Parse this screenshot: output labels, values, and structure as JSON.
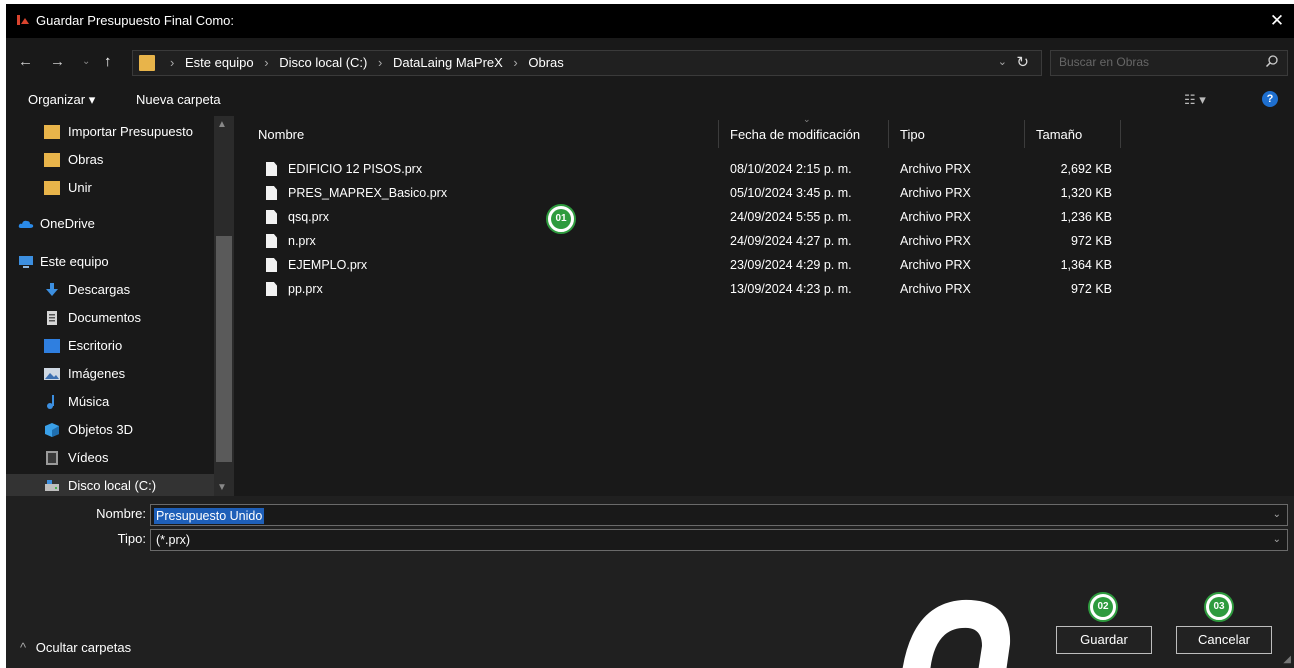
{
  "window": {
    "title": "Guardar Presupuesto Final Como:"
  },
  "address": {
    "crumbs": [
      "Este equipo",
      "Disco local (C:)",
      "DataLaing MaPreX",
      "Obras"
    ],
    "search_placeholder": "Buscar en Obras"
  },
  "toolbar": {
    "organize": "Organizar ▾",
    "new_folder": "Nueva carpeta"
  },
  "sidebar": {
    "items": [
      {
        "label": "Importar Presupuesto",
        "icon": "folder-icon"
      },
      {
        "label": "Obras",
        "icon": "folder-icon"
      },
      {
        "label": "Unir",
        "icon": "folder-icon"
      },
      {
        "label": "OneDrive",
        "icon": "cloud-icon"
      },
      {
        "label": "Este equipo",
        "icon": "computer-icon"
      },
      {
        "label": "Descargas",
        "icon": "download-icon"
      },
      {
        "label": "Documentos",
        "icon": "document-icon"
      },
      {
        "label": "Escritorio",
        "icon": "desktop-icon"
      },
      {
        "label": "Imágenes",
        "icon": "pictures-icon"
      },
      {
        "label": "Música",
        "icon": "music-icon"
      },
      {
        "label": "Objetos 3D",
        "icon": "cube-icon"
      },
      {
        "label": "Vídeos",
        "icon": "video-icon"
      },
      {
        "label": "Disco local (C:)",
        "icon": "drive-icon"
      }
    ]
  },
  "filelist": {
    "columns": {
      "name": "Nombre",
      "date": "Fecha de modificación",
      "type": "Tipo",
      "size": "Tamaño"
    },
    "rows": [
      {
        "name": "EDIFICIO 12 PISOS.prx",
        "date": "08/10/2024 2:15 p. m.",
        "type": "Archivo PRX",
        "size": "2,692 KB"
      },
      {
        "name": "PRES_MAPREX_Basico.prx",
        "date": "05/10/2024 3:45 p. m.",
        "type": "Archivo PRX",
        "size": "1,320 KB"
      },
      {
        "name": "qsq.prx",
        "date": "24/09/2024 5:55 p. m.",
        "type": "Archivo PRX",
        "size": "1,236 KB"
      },
      {
        "name": "n.prx",
        "date": "24/09/2024 4:27 p. m.",
        "type": "Archivo PRX",
        "size": "972 KB"
      },
      {
        "name": "EJEMPLO.prx",
        "date": "23/09/2024 4:29 p. m.",
        "type": "Archivo PRX",
        "size": "1,364 KB"
      },
      {
        "name": "pp.prx",
        "date": "13/09/2024 4:23 p. m.",
        "type": "Archivo PRX",
        "size": "972 KB"
      }
    ]
  },
  "form": {
    "name_label": "Nombre:",
    "name_value": "Presupuesto Unido",
    "type_label": "Tipo:",
    "type_value": "(*.prx)"
  },
  "footer": {
    "hide_folders": "Ocultar carpetas",
    "save": "Guardar",
    "cancel": "Cancelar"
  },
  "badges": [
    "01",
    "02",
    "03"
  ],
  "colors": {
    "accent": "#2e9b3e",
    "selection": "#1e5fb8",
    "folder": "#e8b44a"
  }
}
